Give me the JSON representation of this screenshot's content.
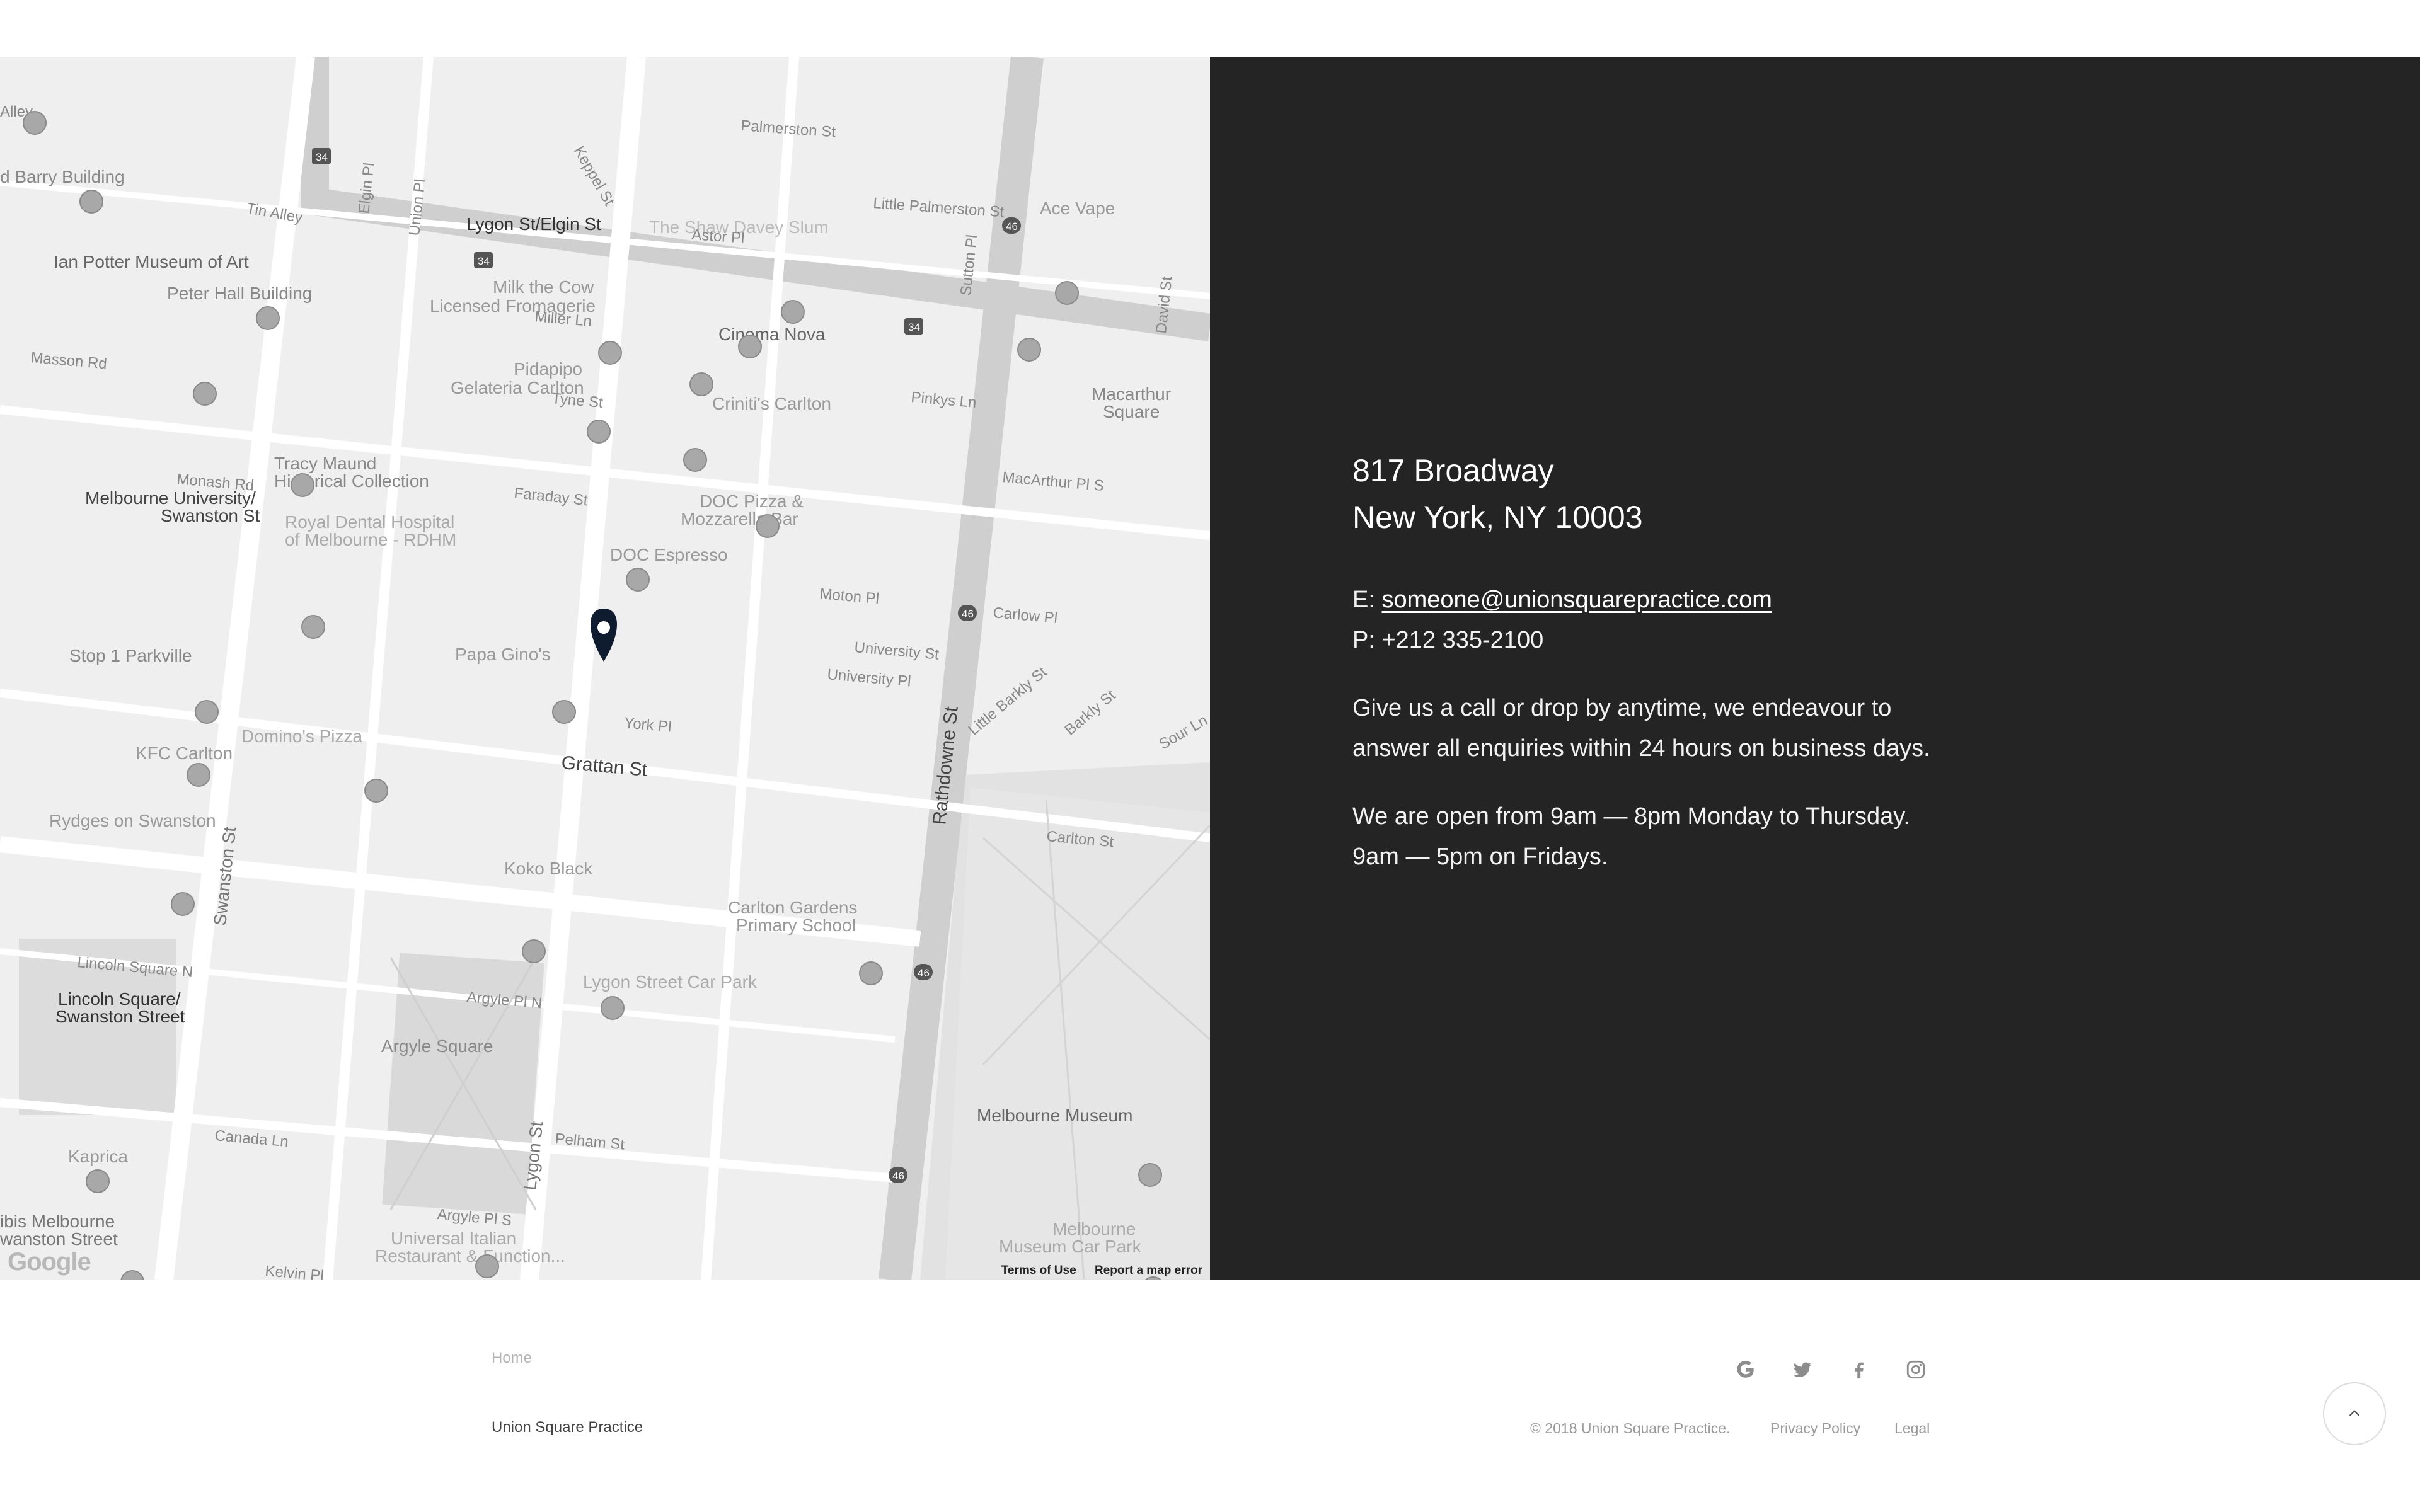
{
  "map": {
    "labels": {
      "lygon_elgin_st": "Lygon St/Elgin St",
      "ian_potter": "Ian Potter Museum of Art",
      "peter_hall": "Peter Hall Building",
      "barry_building": "d Barry Building",
      "milk_the_cow": "Milk the Cow",
      "licensed_fromagerie": "Licensed Fromagerie",
      "cinema_nova": "Cinema Nova",
      "pidapipo": "Pidapipo",
      "gelateria_carlton": "Gelateria Carlton",
      "criniti": "Criniti's Carlton",
      "tracy_maund": "Tracy Maund",
      "historical_collection": "Historical Collection",
      "melb_uni": "Melbourne University/",
      "swanston_st_stop": "Swanston St",
      "royal_dental": "Royal Dental Hospital",
      "of_melbourne": "of Melbourne - RDHM",
      "doc_pizza": "DOC Pizza &",
      "mozzarella_bar": "Mozzarella Bar",
      "doc_espresso": "DOC Espresso",
      "stop1": "Stop 1 Parkville",
      "papa_ginos": "Papa Gino's",
      "kfc": "KFC Carlton",
      "dominos": "Domino's Pizza",
      "grattan_st": "Grattan St",
      "rydges": "Rydges on Swanston",
      "koko_black": "Koko Black",
      "carlton_gardens": "Carlton Gardens",
      "primary_school": "Primary School",
      "lygon_car_park": "Lygon Street Car Park",
      "lincoln_square": "Lincoln Square/",
      "swanston_street": "Swanston Street",
      "argyle_square": "Argyle Square",
      "kaprica": "Kaprica",
      "melbourne_museum": "Melbourne Museum",
      "museum_car_park": "Melbourne",
      "museum_car_park2": "Museum Car Park",
      "universal": "Universal Italian",
      "universal2": "Restaurant & Function...",
      "ibis": "ibis Melbourne",
      "ibis2": "wanston Street",
      "ace_vape": "Ace Vape",
      "macarthur_square": "Macarthur",
      "macarthur_square2": "Square",
      "shaw_davey": "The Shaw Davey Slum",
      "rathdowne_st": "Rathdowne St",
      "swanston_st_road": "Swanston St",
      "lygon_st_road": "Lygon St",
      "faraday_st": "Faraday St",
      "palmerston_st": "Palmerston St",
      "little_palmerston": "Little Palmerston St",
      "tin_alley": "Tin Alley",
      "masson_rd": "Masson Rd",
      "monash_rd": "Monash Rd",
      "astor_pl": "Astor Pl",
      "miller_ln": "Miller Ln",
      "tyne_st": "Tyne St",
      "pinkys_ln": "Pinkys Ln",
      "macarthur_pl": "MacArthur Pl S",
      "carlow_pl": "Carlow Pl",
      "moton_pl": "Moton Pl",
      "university_st": "University St",
      "university_pl": "University Pl",
      "york_pl": "York Pl",
      "carlton_st": "Carlton St",
      "pelham_st": "Pelham St",
      "canada_ln": "Canada Ln",
      "argyle_pl_n": "Argyle Pl N",
      "argyle_pl_s": "Argyle Pl S",
      "kelvin_pl": "Kelvin Pl",
      "lincoln_square_n": "Lincoln Square N",
      "barkly_st": "Barkly St",
      "little_barkly": "Little Barkly St",
      "sour_ln": "Sour Ln",
      "david_st": "David St",
      "keppel_st": "Keppel St",
      "elgin_pl": "Elgin Pl",
      "union_pl": "Union Pl",
      "sutton_pl": "Sutton Pl",
      "alley": "Alley"
    },
    "badges": {
      "b34": "34",
      "b46": "46"
    },
    "terms_label": "Terms of Use",
    "report_label": "Report a map error",
    "google_logo": "Google",
    "pin_icon": "location-pin-icon"
  },
  "contact": {
    "address_line1": "817 Broadway",
    "address_line2": "New York, NY 10003",
    "email_prefix": "E: ",
    "email": "someone@unionsquarepractice.com",
    "phone_prefix": "P: ",
    "phone": "+212 335-2100",
    "message_line1": "Give us a call or drop by anytime, we endeavour to",
    "message_line2": "answer all enquiries within 24 hours on business days.",
    "hours_line1": "We are open from 9am — 8pm Monday to Thursday.",
    "hours_line2": "9am — 5pm on Fridays."
  },
  "footer": {
    "home_label": "Home",
    "brand": "Union Square Practice",
    "copyright": "© 2018 Union Square Practice.",
    "privacy": "Privacy Policy",
    "legal": "Legal",
    "social_icons": [
      "google-icon",
      "twitter-icon",
      "facebook-icon",
      "instagram-icon"
    ]
  },
  "colors": {
    "panel_bg": "#242424",
    "map_bg": "#ececec",
    "pin": "#0f1b2e"
  }
}
